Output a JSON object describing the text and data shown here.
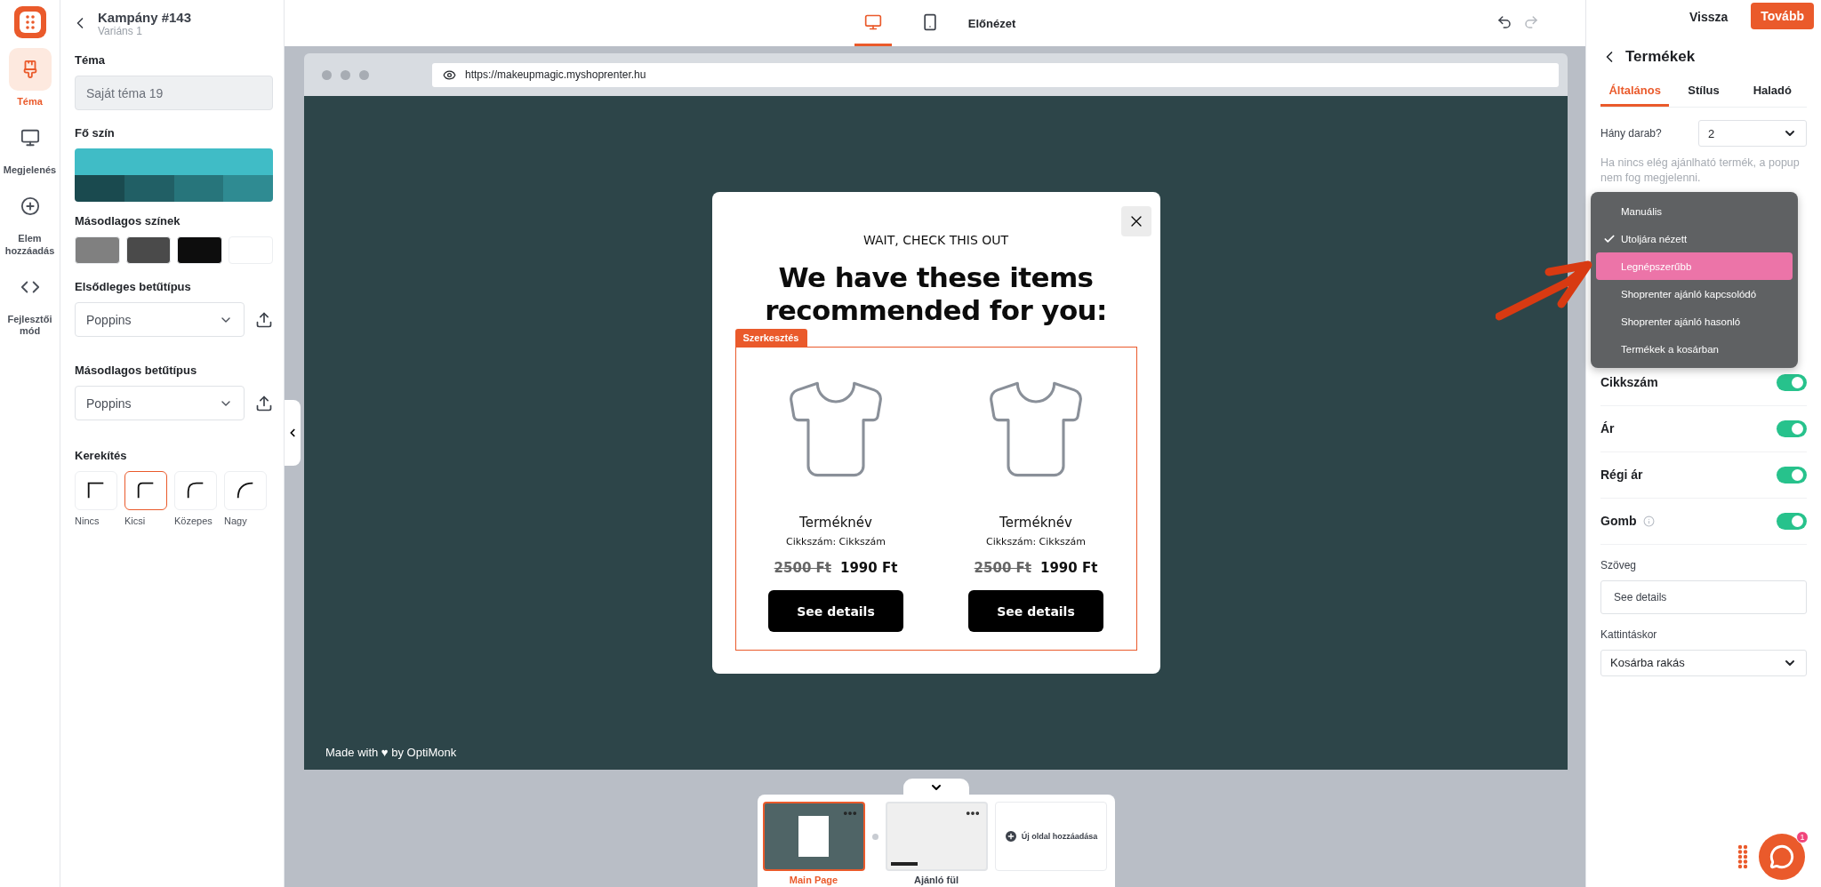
{
  "rail": {
    "items": [
      {
        "kind": "brush",
        "label": "Téma",
        "selected": true
      },
      {
        "kind": "monitor",
        "label": "Megjelenés",
        "selected": false
      },
      {
        "kind": "plus",
        "label": "Elem hozzáadás",
        "selected": false
      },
      {
        "kind": "code",
        "label": "Fejlesztői mód",
        "selected": false
      }
    ]
  },
  "header": {
    "title": "Kampány #143",
    "subtitle": "Variáns 1"
  },
  "theme_panel": {
    "theme_label": "Téma",
    "theme_value": "Saját téma 19",
    "main_color_label": "Fő szín",
    "main_palette": [
      {
        "kind": "base",
        "color": "#40bcc6"
      },
      {
        "kind": "shade",
        "color": "#1a4a4f"
      },
      {
        "kind": "shade",
        "color": "#215f65"
      },
      {
        "kind": "shade",
        "color": "#27757b"
      },
      {
        "kind": "shade",
        "color": "#2f8b92"
      }
    ],
    "secondary_label": "Másodlagos színek",
    "secondary_colors": [
      {
        "color": "#808080"
      },
      {
        "color": "#4a4a4a"
      },
      {
        "color": "#0d0d0d"
      },
      {
        "color": "#ffffff"
      }
    ],
    "primary_font_label": "Elsődleges betűtípus",
    "primary_font": "Poppins",
    "secondary_font_label": "Másodlagos betűtípus",
    "secondary_font": "Poppins",
    "rounding_label": "Kerekítés",
    "rounding": [
      {
        "kind": "none",
        "label": "Nincs",
        "selected": false
      },
      {
        "kind": "small",
        "label": "Kicsi",
        "selected": true
      },
      {
        "kind": "medium",
        "label": "Közepes",
        "selected": false
      },
      {
        "kind": "large",
        "label": "Nagy",
        "selected": false
      }
    ]
  },
  "toolbar": {
    "devices": [
      {
        "kind": "desktop",
        "selected": true
      },
      {
        "kind": "mobile",
        "selected": false
      }
    ],
    "preview": "Előnézet"
  },
  "browser": {
    "url": "https://makeupmagic.myshoprenter.hu",
    "footer": "Made with ♥ by OptiMonk"
  },
  "popup": {
    "kicker": "WAIT, CHECK THIS OUT",
    "headline": "We have these items recommended for you:",
    "edit_tag": "Szerkesztés",
    "products": [
      {
        "name": "Terméknév",
        "sku": "Cikkszám: Cikkszám",
        "old_price": "2500 Ft",
        "price": "1990 Ft",
        "button": "See details"
      },
      {
        "name": "Terméknév",
        "sku": "Cikkszám: Cikkszám",
        "old_price": "2500 Ft",
        "price": "1990 Ft",
        "button": "See details"
      }
    ]
  },
  "pages": {
    "items": [
      {
        "kind": "main",
        "label": "Main Page",
        "selected": true
      },
      {
        "kind": "tab",
        "label": "Ajánló fül",
        "selected": false
      }
    ],
    "add_label": "Új oldal hozzáadása"
  },
  "right_panel": {
    "back": "Vissza",
    "next": "Tovább",
    "title": "Termékek",
    "tabs": [
      {
        "label": "Általános",
        "selected": true
      },
      {
        "label": "Stílus",
        "selected": false
      },
      {
        "label": "Haladó",
        "selected": false
      }
    ],
    "count_label": "Hány darab?",
    "count_value": "2",
    "hint": "Ha nincs elég ajánlható termék, a popup nem fog megjelenni.",
    "toggles": [
      {
        "label": "Cikkszám",
        "on": true,
        "info": false
      },
      {
        "label": "Ár",
        "on": true,
        "info": false
      },
      {
        "label": "Régi ár",
        "on": true,
        "info": false
      },
      {
        "label": "Gomb",
        "on": true,
        "info": true
      }
    ],
    "text_label": "Szöveg",
    "text_value": "See details",
    "click_label": "Kattintáskor",
    "click_value": "Kosárba rakás"
  },
  "dropdown": {
    "items": [
      {
        "label": "Manuális",
        "checked": false,
        "highlighted": false
      },
      {
        "label": "Utoljára nézett",
        "checked": true,
        "highlighted": false
      },
      {
        "label": "Legnépszerűbb",
        "checked": false,
        "highlighted": true
      },
      {
        "label": "Shoprenter ajánló kapcsolódó",
        "checked": false,
        "highlighted": false
      },
      {
        "label": "Shoprenter ajánló hasonló",
        "checked": false,
        "highlighted": false
      },
      {
        "label": "Termékek a kosárban",
        "checked": false,
        "highlighted": false
      }
    ]
  },
  "chat": {
    "badge": "1"
  }
}
